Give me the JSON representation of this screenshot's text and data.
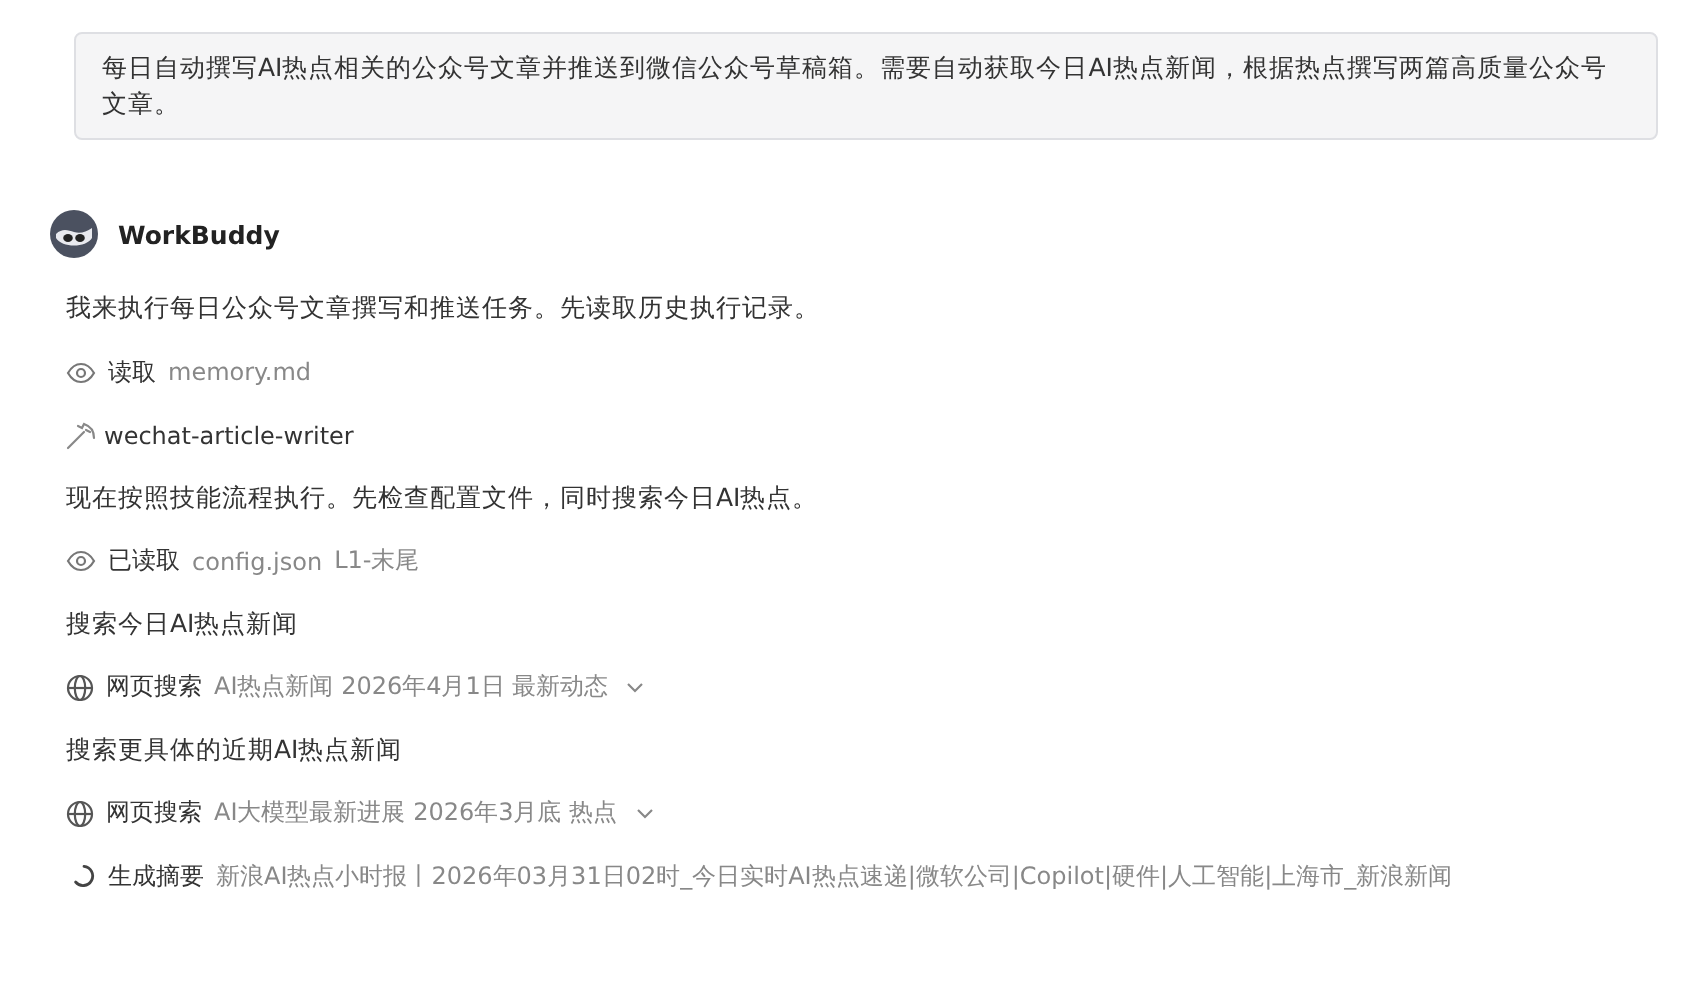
{
  "user_message": "每日自动撰写AI热点相关的公众号文章并推送到微信公众号草稿箱。需要自动获取今日AI热点新闻，根据热点撰写两篇高质量公众号文章。",
  "assistant": {
    "name": "WorkBuddy"
  },
  "steps": [
    {
      "kind": "text",
      "text": "我来执行每日公众号文章撰写和推送任务。先读取历史执行记录。"
    },
    {
      "kind": "read",
      "label": "读取",
      "target": "memory.md"
    },
    {
      "kind": "skill",
      "label": "wechat-article-writer"
    },
    {
      "kind": "text",
      "text": "现在按照技能流程执行。先检查配置文件，同时搜索今日AI热点。"
    },
    {
      "kind": "read",
      "label": "已读取",
      "target": "config.json",
      "range": "L1-末尾"
    },
    {
      "kind": "text",
      "text": "搜索今日AI热点新闻"
    },
    {
      "kind": "search",
      "label": "网页搜索",
      "query": "AI热点新闻 2026年4月1日 最新动态"
    },
    {
      "kind": "text",
      "text": "搜索更具体的近期AI热点新闻"
    },
    {
      "kind": "search",
      "label": "网页搜索",
      "query": "AI大模型最新进展 2026年3月底 热点"
    },
    {
      "kind": "summary",
      "label": "生成摘要",
      "detail": "新浪AI热点小时报丨2026年03月31日02时_今日实时AI热点速递|微软公司|Copilot|硬件|人工智能|上海市_新浪新闻"
    }
  ]
}
